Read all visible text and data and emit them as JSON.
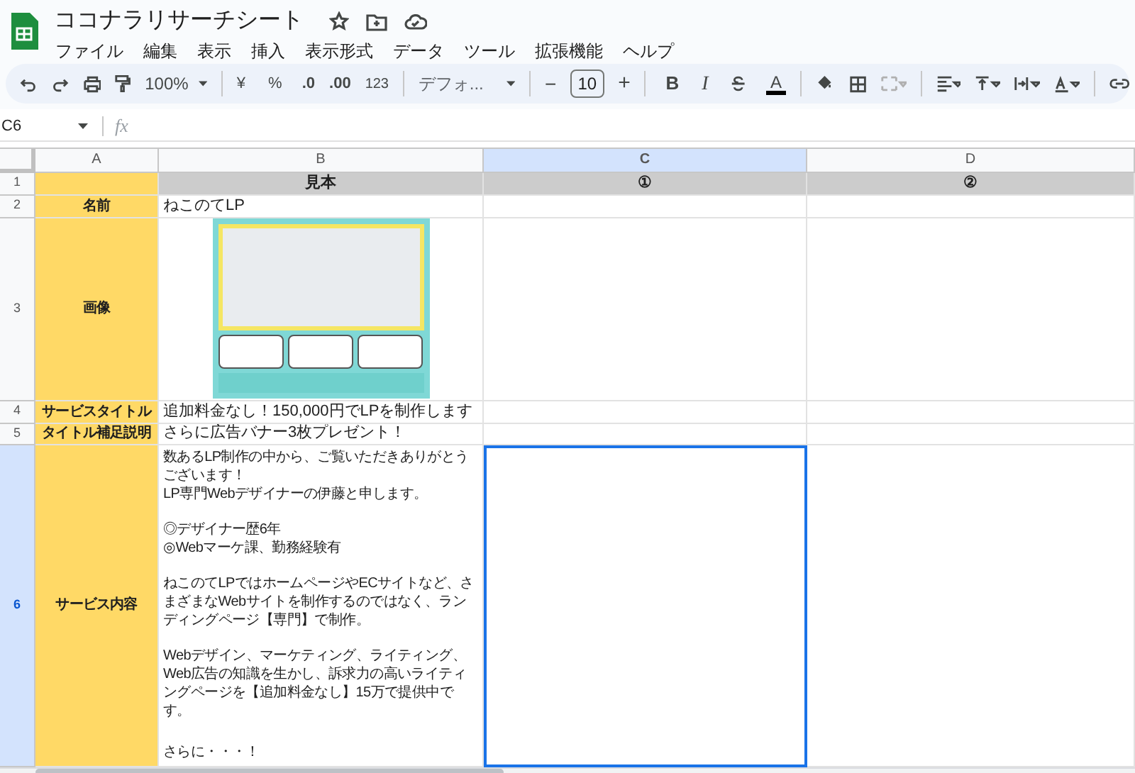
{
  "app": {
    "title": "ココナラリサーチシート",
    "menu": [
      "ファイル",
      "編集",
      "表示",
      "挿入",
      "表示形式",
      "データ",
      "ツール",
      "拡張機能",
      "ヘルプ"
    ]
  },
  "toolbar": {
    "zoom": "100%",
    "currency": "¥",
    "percent": "%",
    "decimal_decrease": ".0",
    "decimal_increase": ".00",
    "number_format": "123",
    "font": "デフォ...",
    "font_size": "10",
    "minus": "−",
    "plus": "+",
    "bold": "B",
    "italic": "I",
    "text_color": "A"
  },
  "formula_bar": {
    "cell_ref": "C6",
    "fx": "fx"
  },
  "columns": [
    {
      "label": "A",
      "selected": false
    },
    {
      "label": "B",
      "selected": false
    },
    {
      "label": "C",
      "selected": true
    },
    {
      "label": "D",
      "selected": false
    }
  ],
  "rows": [
    {
      "number": "1",
      "selected": false,
      "cells": [
        {
          "kind": "label",
          "selected": false
        },
        {
          "kind": "header",
          "text": "見本",
          "selected": false
        },
        {
          "kind": "header",
          "text": "①",
          "selected": false
        },
        {
          "kind": "header",
          "text": "②",
          "selected": false
        }
      ]
    },
    {
      "number": "2",
      "selected": false,
      "cells": [
        {
          "kind": "label",
          "text": "名前",
          "selected": false
        },
        {
          "kind": "text",
          "text": "ねこのてLP",
          "selected": false
        },
        {
          "kind": "text",
          "selected": false
        },
        {
          "kind": "text",
          "selected": false
        }
      ]
    },
    {
      "number": "3",
      "selected": false,
      "cells": [
        {
          "kind": "label",
          "text": "画像",
          "selected": false
        },
        {
          "kind": "image",
          "selected": false
        },
        {
          "kind": "text",
          "selected": false
        },
        {
          "kind": "text",
          "selected": false
        }
      ]
    },
    {
      "number": "4",
      "selected": false,
      "cells": [
        {
          "kind": "label",
          "text": "サービスタイトル",
          "selected": false
        },
        {
          "kind": "text",
          "text": "追加料金なし！150,000円でLPを制作します",
          "selected": false
        },
        {
          "kind": "text",
          "selected": false
        },
        {
          "kind": "text",
          "selected": false
        }
      ]
    },
    {
      "number": "5",
      "selected": false,
      "cells": [
        {
          "kind": "label",
          "text": "タイトル補足説明",
          "selected": false
        },
        {
          "kind": "text",
          "text": "さらに広告バナー3枚プレゼント！",
          "selected": false
        },
        {
          "kind": "text",
          "selected": false
        },
        {
          "kind": "text",
          "selected": false
        }
      ]
    },
    {
      "number": "6",
      "selected": true,
      "cells": [
        {
          "kind": "label",
          "text": "サービス内容",
          "selected": false
        },
        {
          "kind": "long",
          "paragraphs": [
            [
              "数あるLP制作の中から、ご覧いただきありがとうございます！",
              "LP専門Webデザイナーの伊藤と申します。"
            ],
            [
              "◎デザイナー歴6年",
              "◎Webマーケ課、勤務経験有"
            ],
            [
              "ねこのてLPではホームページやECサイトなど、さまざまなWebサイトを制作するのではなく、ランディングページ【専門】で制作。"
            ],
            [
              "Webデザイン、マーケティング、ライティング、Web広告の知識を生かし、訴求力の高いライティングページを【追加料金なし】15万で提供中です。"
            ],
            [
              "さらに・・・！"
            ]
          ],
          "selected": false
        },
        {
          "kind": "text",
          "selected": true
        },
        {
          "kind": "text",
          "selected": false
        }
      ]
    }
  ]
}
